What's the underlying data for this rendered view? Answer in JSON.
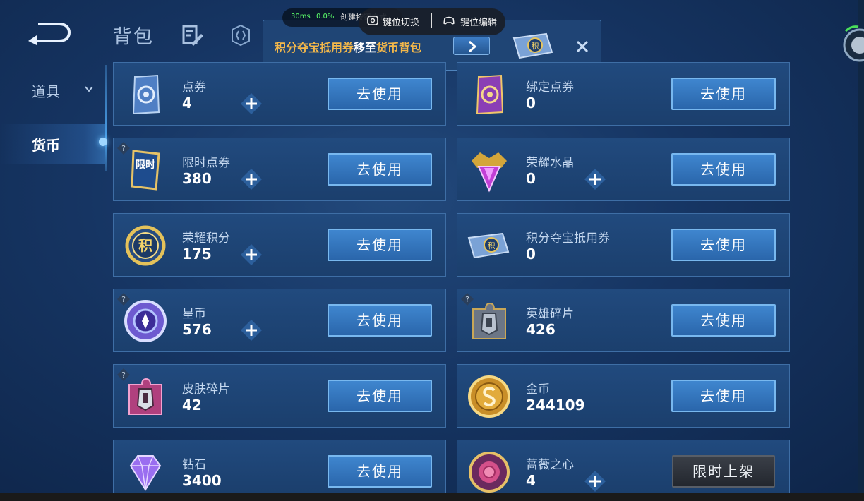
{
  "header": {
    "title": "背包"
  },
  "overlay": {
    "ping": "30ms",
    "loss": "0.0%",
    "tool_text": "创建按键方式",
    "key_switch": "键位切换",
    "key_edit": "键位编辑"
  },
  "notice": {
    "item": "积分夺宝抵用券",
    "mid": "移至",
    "target": "货币背包"
  },
  "sidebar": {
    "items": [
      {
        "label": "道具"
      },
      {
        "label": "货币"
      }
    ]
  },
  "cards": [
    {
      "name": "点券",
      "count": "4",
      "button": "去使用"
    },
    {
      "name": "绑定点券",
      "count": "0",
      "button": "去使用"
    },
    {
      "name": "限时点券",
      "count": "380",
      "button": "去使用"
    },
    {
      "name": "荣耀水晶",
      "count": "0",
      "button": "去使用"
    },
    {
      "name": "荣耀积分",
      "count": "175",
      "button": "去使用"
    },
    {
      "name": "积分夺宝抵用券",
      "count": "0",
      "button": "去使用"
    },
    {
      "name": "星币",
      "count": "576",
      "button": "去使用"
    },
    {
      "name": "英雄碎片",
      "count": "426",
      "button": "去使用"
    },
    {
      "name": "皮肤碎片",
      "count": "42",
      "button": "去使用"
    },
    {
      "name": "金币",
      "count": "244109",
      "button": "去使用"
    },
    {
      "name": "钻石",
      "count": "3400",
      "button": "去使用"
    },
    {
      "name": "蔷薇之心",
      "count": "4",
      "button": "限时上架"
    }
  ],
  "icon_badges": {
    "ticket_mark": "积",
    "limit_mark": "限时"
  }
}
